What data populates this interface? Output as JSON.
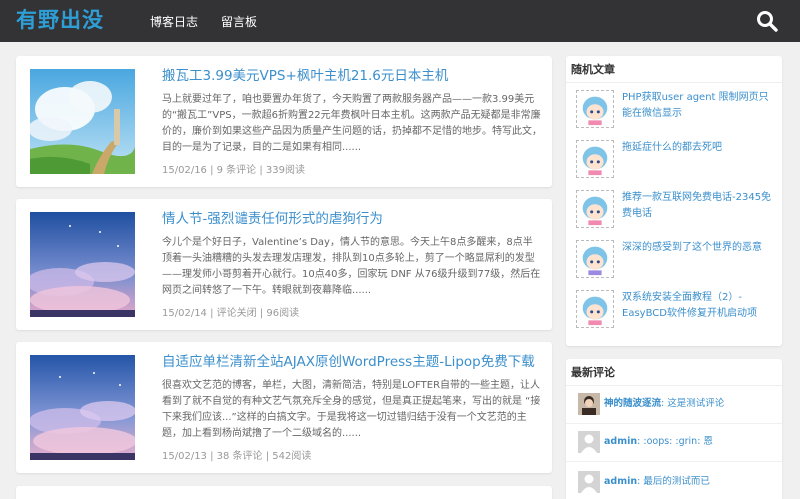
{
  "header": {
    "logo": "有野出没",
    "nav": [
      "博客日志",
      "留言板"
    ]
  },
  "posts": [
    {
      "title": "搬瓦工3.99美元VPS+枫叶主机21.6元日本主机",
      "excerpt": "马上就要过年了，咱也要置办年货了，今天购置了两款服务器产品——一款3.99美元的“搬瓦工”VPS，一款超6折购置22元年费枫叶日本主机。这两款产品无疑都是非常廉价的，廉价到如果这些产品因为质量产生问题的话，扔掉都不足惜的地步。特写此文，目的一是为了记录，目的二是如果有相同......",
      "meta": "15/02/16 | 9 条评论 | 339阅读"
    },
    {
      "title": "情人节-强烈谴责任何形式的虐狗行为",
      "excerpt": "今儿个是个好日子，Valentine’s Day，情人节的意思。今天上午8点多醒来，8点半顶着一头油糟糟的头发去理发店理发，排队到10点多轮上，剪了一个略显屌利的发型——理发师小哥剪着开心就行。10点40多，回家玩 DNF 从76级升级到77级，然后在网页之间转悠了一下午。转眼就到夜幕降临......",
      "meta": "15/02/14 | 评论关闭 | 96阅读"
    },
    {
      "title": "自适应单栏清新全站AJAX原创WordPress主题-Lipop免费下载",
      "excerpt": "很喜欢文艺范的博客，单栏，大图，清新简洁，特别是LOFTER自带的一些主题，让人看到了就不自觉的有种文艺气氛充斥全身的感觉，但是真正提起笔来，写出的就是 “接下来我们应该...”这样的白搞文字。于是我将这一切过错归结于没有一个文艺范的主题，加上看到杨尚斌撸了一个二级域名的......",
      "meta": "15/02/13 | 38 条评论 | 542阅读"
    }
  ],
  "sidebar": {
    "random_title": "随机文章",
    "random": [
      "PHP获取user agent 限制网页只能在微信显示",
      "拖延症什么的都去死吧",
      "推荐一款互联网免费电话-2345免费电话",
      "深深的感受到了这个世界的恶意",
      "双系统安装全面教程（2）- EasyBCD软件修复开机启动项"
    ],
    "comments_title": "最新评论",
    "comments": [
      {
        "author": "神的随波逐流",
        "text": "这是测试评论"
      },
      {
        "author": "admin",
        "text": ":oops: :grin: 恩"
      },
      {
        "author": "admin",
        "text": "最后的测试而已"
      }
    ]
  },
  "colors": {
    "accent": "#3b8fcc",
    "topbar": "#333336",
    "logo": "#2e9fd6"
  }
}
